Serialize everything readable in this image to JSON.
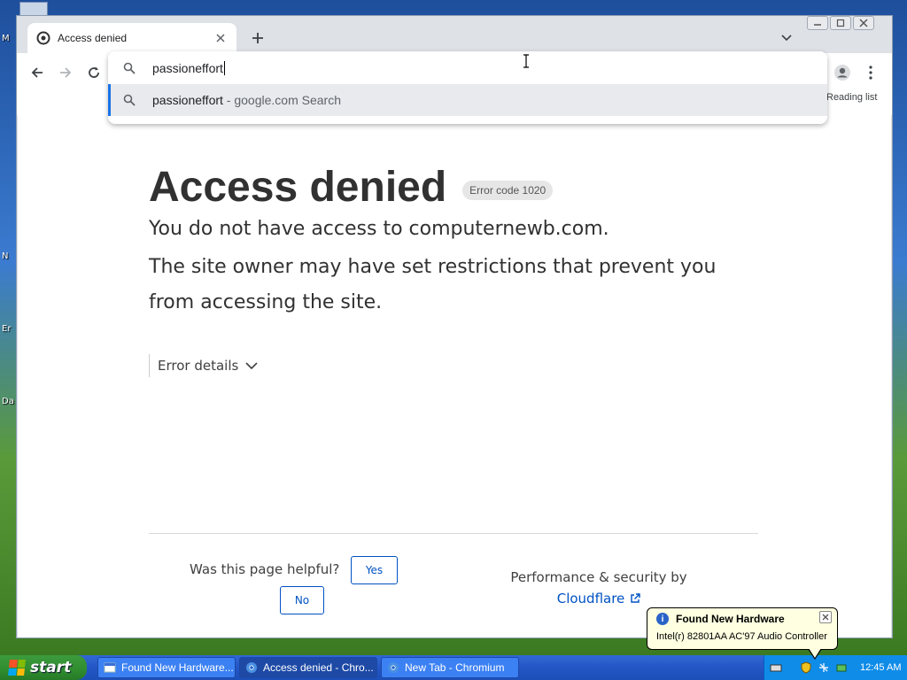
{
  "desktop": {
    "labels": [
      "M",
      "N",
      "Er",
      "Da"
    ]
  },
  "browser": {
    "tab": {
      "title": "Access denied",
      "favicon": "cloudflare-shield-icon",
      "close_icon": "close-icon"
    },
    "new_tab_icon": "plus-icon",
    "tab_search_icon": "chevron-down-icon",
    "window_controls": [
      "minimize-icon",
      "maximize-icon",
      "close-icon"
    ],
    "nav": {
      "back": "arrow-left-icon",
      "forward": "arrow-right-icon",
      "reload": "reload-icon"
    },
    "reading_list": "Reading list",
    "omnibox": {
      "value": "passioneffort",
      "suggestion_main": "passioneffort",
      "suggestion_sub": " - google.com Search"
    }
  },
  "page": {
    "title": "Access denied",
    "error_code": "Error code 1020",
    "line1": "You do not have access to computernewb.com.",
    "line2": "The site owner may have set restrictions that prevent you from accessing the site.",
    "error_details": "Error details",
    "helpful_question": "Was this page helpful?",
    "yes": "Yes",
    "no": "No",
    "perf_label": "Performance & security by",
    "cf_link": "Cloudflare"
  },
  "balloon": {
    "title": "Found New Hardware",
    "text": "Intel(r) 82801AA AC'97 Audio Controller"
  },
  "taskbar": {
    "start": "start",
    "tasks": [
      {
        "label": "Found New Hardware..."
      },
      {
        "label": "Access denied - Chro..."
      },
      {
        "label": "New Tab - Chromium"
      }
    ],
    "clock": "12:45 AM"
  },
  "colors": {
    "accent": "#1a73e8",
    "cf_blue": "#0051c3",
    "taskbar": "#2456c5",
    "start_green": "#2f8c2f"
  }
}
